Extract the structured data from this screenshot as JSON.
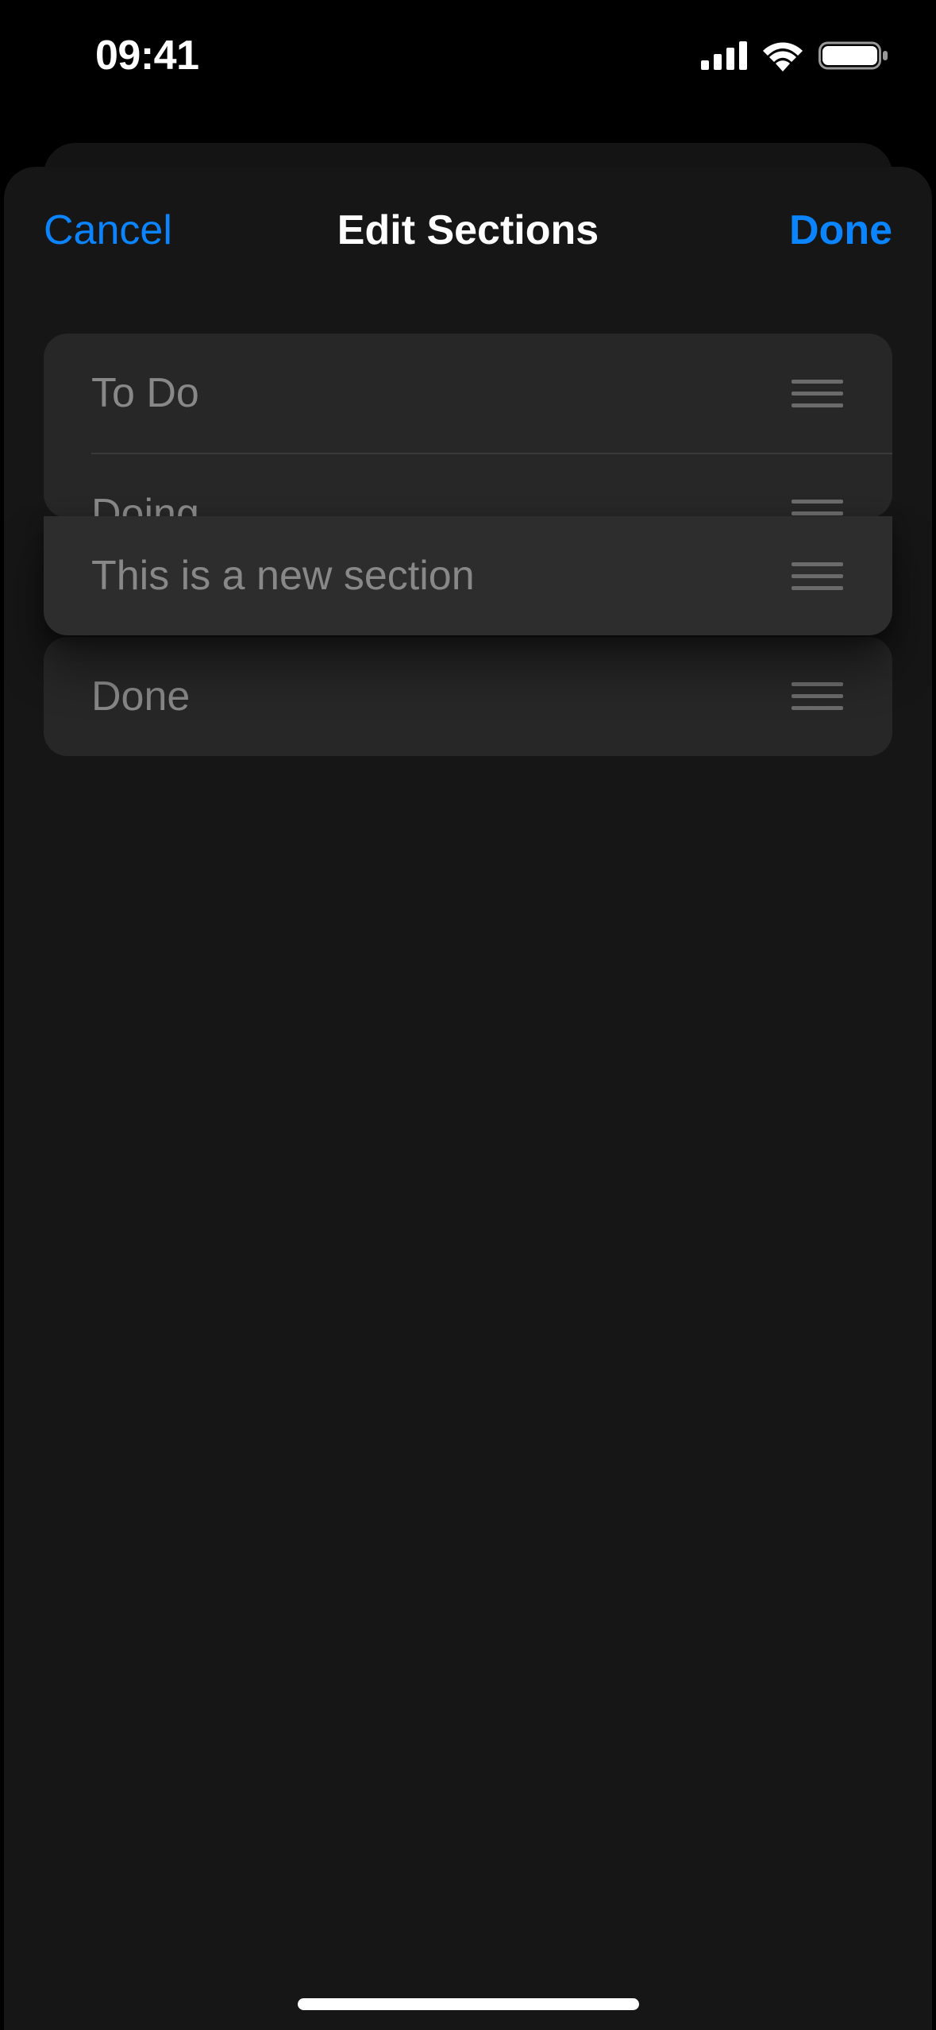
{
  "status_bar": {
    "time": "09:41"
  },
  "nav": {
    "cancel_label": "Cancel",
    "title": "Edit Sections",
    "done_label": "Done"
  },
  "sections": {
    "group_top": [
      {
        "label": "To Do"
      },
      {
        "label": "Doing"
      }
    ],
    "dragging": {
      "label": "This is a new section"
    },
    "group_bottom": [
      {
        "label": "Done"
      }
    ]
  }
}
